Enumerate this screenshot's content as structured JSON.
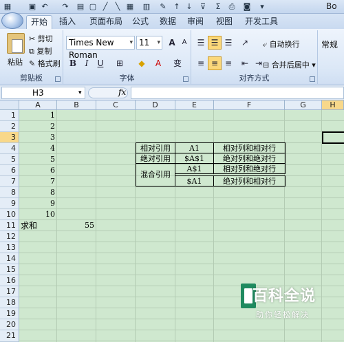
{
  "window": {
    "title": "Bo"
  },
  "tabs": [
    {
      "label": "开始",
      "active": true
    },
    {
      "label": "插入"
    },
    {
      "label": "页面布局"
    },
    {
      "label": "公式"
    },
    {
      "label": "数据"
    },
    {
      "label": "审阅"
    },
    {
      "label": "视图"
    },
    {
      "label": "开发工具"
    }
  ],
  "ribbon": {
    "clipboard": {
      "paste": "粘贴",
      "cut": "剪切",
      "copy": "复制",
      "format_painter": "格式刷",
      "label": "剪贴板"
    },
    "font": {
      "name": "Times New Roman",
      "size": "11",
      "bold": "B",
      "italic": "I",
      "underline": "U",
      "label": "字体",
      "grow": "A",
      "shrink": "A",
      "font_color": "A",
      "phonetic": "变"
    },
    "alignment": {
      "wrap_text": "自动换行",
      "merge_center": "合并后居中",
      "label": "对齐方式"
    },
    "number": {
      "format": "常规"
    }
  },
  "formula_bar": {
    "name_box": "H3",
    "fx": "fx",
    "value": ""
  },
  "grid": {
    "columns": [
      "A",
      "B",
      "C",
      "D",
      "E",
      "F",
      "G",
      "H"
    ],
    "active_column": "H",
    "rows": [
      "1",
      "2",
      "3",
      "4",
      "5",
      "6",
      "7",
      "8",
      "9",
      "10",
      "11",
      "12",
      "13",
      "14",
      "15",
      "16",
      "17",
      "18",
      "19",
      "20",
      "21"
    ],
    "active_row": "3",
    "column_a_values": [
      "1",
      "2",
      "3",
      "4",
      "5",
      "6",
      "7",
      "8",
      "9",
      "10"
    ],
    "a11": "求和",
    "b11": "55",
    "table": {
      "d4": "相对引用",
      "e4": "A1",
      "f4": "相对列和相对行",
      "d5": "绝对引用",
      "e5": "$A$1",
      "f5": "绝对列和绝对行",
      "d6_7": "混合引用",
      "e6": "A$1",
      "f6": "相对列和绝对行",
      "e7": "$A1",
      "f7": "绝对列和相对行"
    }
  },
  "watermark": {
    "title": "百科全说",
    "subtitle": "助你轻松解决"
  }
}
